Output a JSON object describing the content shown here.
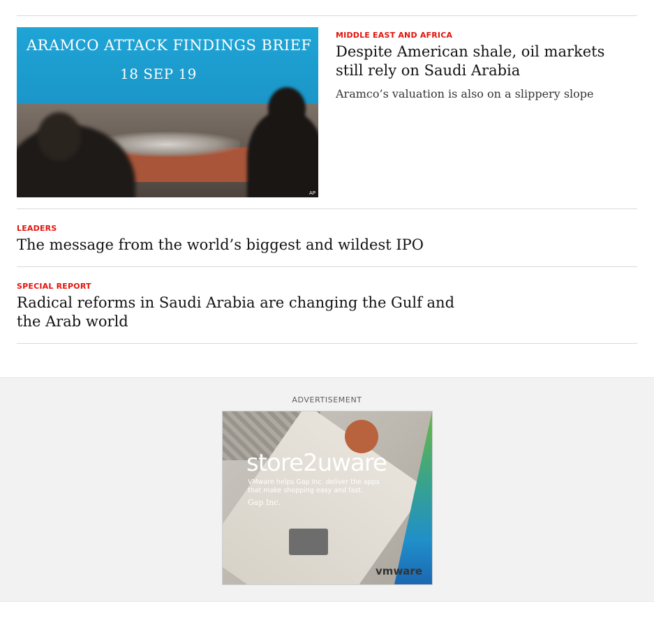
{
  "articles": [
    {
      "section": "Middle East and Africa",
      "headline": "Despite American shale, oil markets still rely on Saudi Arabia",
      "description": "Aramco’s valuation is also on a slippery slope",
      "image": {
        "banner_line1": "ARAMCO ATTACK FINDINGS BRIEF",
        "banner_line2": "18 SEP 19",
        "credit": "AP"
      }
    },
    {
      "section": "Leaders",
      "headline": "The message from the world’s biggest and wildest IPO"
    },
    {
      "section": "Special report",
      "headline": "Radical reforms in Saudi Arabia are changing the Gulf and the Arab world"
    }
  ],
  "advertisement": {
    "label": "Advertisement",
    "brand": "store2uware",
    "tagline": "VMware helps Gap Inc. deliver the apps that make shopping easy and fast.",
    "client": "Gap Inc.",
    "logo": "vmware"
  }
}
